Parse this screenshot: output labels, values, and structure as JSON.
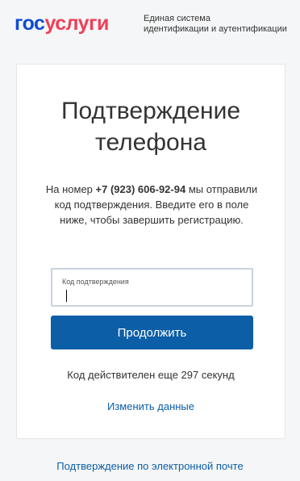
{
  "header": {
    "logo_part1": "гос",
    "logo_part2": "услуги",
    "tagline_line1": "Единая система",
    "tagline_line2": "идентификации и аутентификации"
  },
  "card": {
    "title_line1": "Подтверждение",
    "title_line2": "телефона",
    "message_prefix": "На номер ",
    "phone": "+7 (923) 606-92-94",
    "message_suffix": " мы отправили код подтверждения. Введите его в поле ниже, чтобы завершить регистрацию.",
    "code_field": {
      "label": "Код подтверждения",
      "value": ""
    },
    "continue_label": "Продолжить",
    "timer_text": "Код действителен еще 297 секунд",
    "change_link": "Изменить данные"
  },
  "footer": {
    "email_confirm_link": "Подтверждение по электронной почте"
  },
  "colors": {
    "brand_blue": "#0d4cd3",
    "brand_red": "#ee3f58",
    "button_bg": "#0c5ea6",
    "link": "#0c5ea6"
  }
}
